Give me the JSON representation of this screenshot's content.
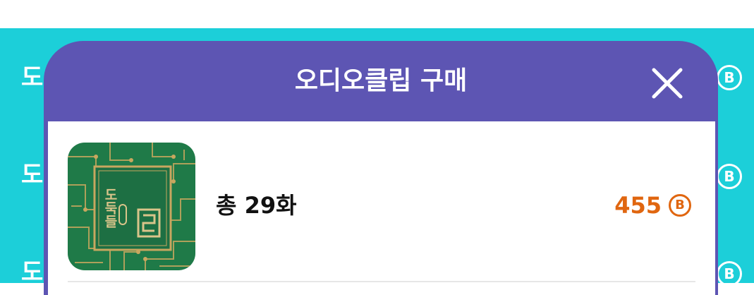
{
  "background": {
    "teal_color": "#1ccfd9",
    "rows": [
      {
        "text": "도",
        "coin": "B"
      },
      {
        "text": "도",
        "coin": "B"
      },
      {
        "text": "도",
        "coin": "B"
      }
    ]
  },
  "modal": {
    "title": "오디오클립 구매",
    "header_color": "#5d55b3",
    "close_icon": "close-icon",
    "item": {
      "thumbnail_title": "도둑들",
      "count_label": "총 29화",
      "price": "455",
      "currency_symbol": "B",
      "price_color": "#e06610"
    }
  }
}
